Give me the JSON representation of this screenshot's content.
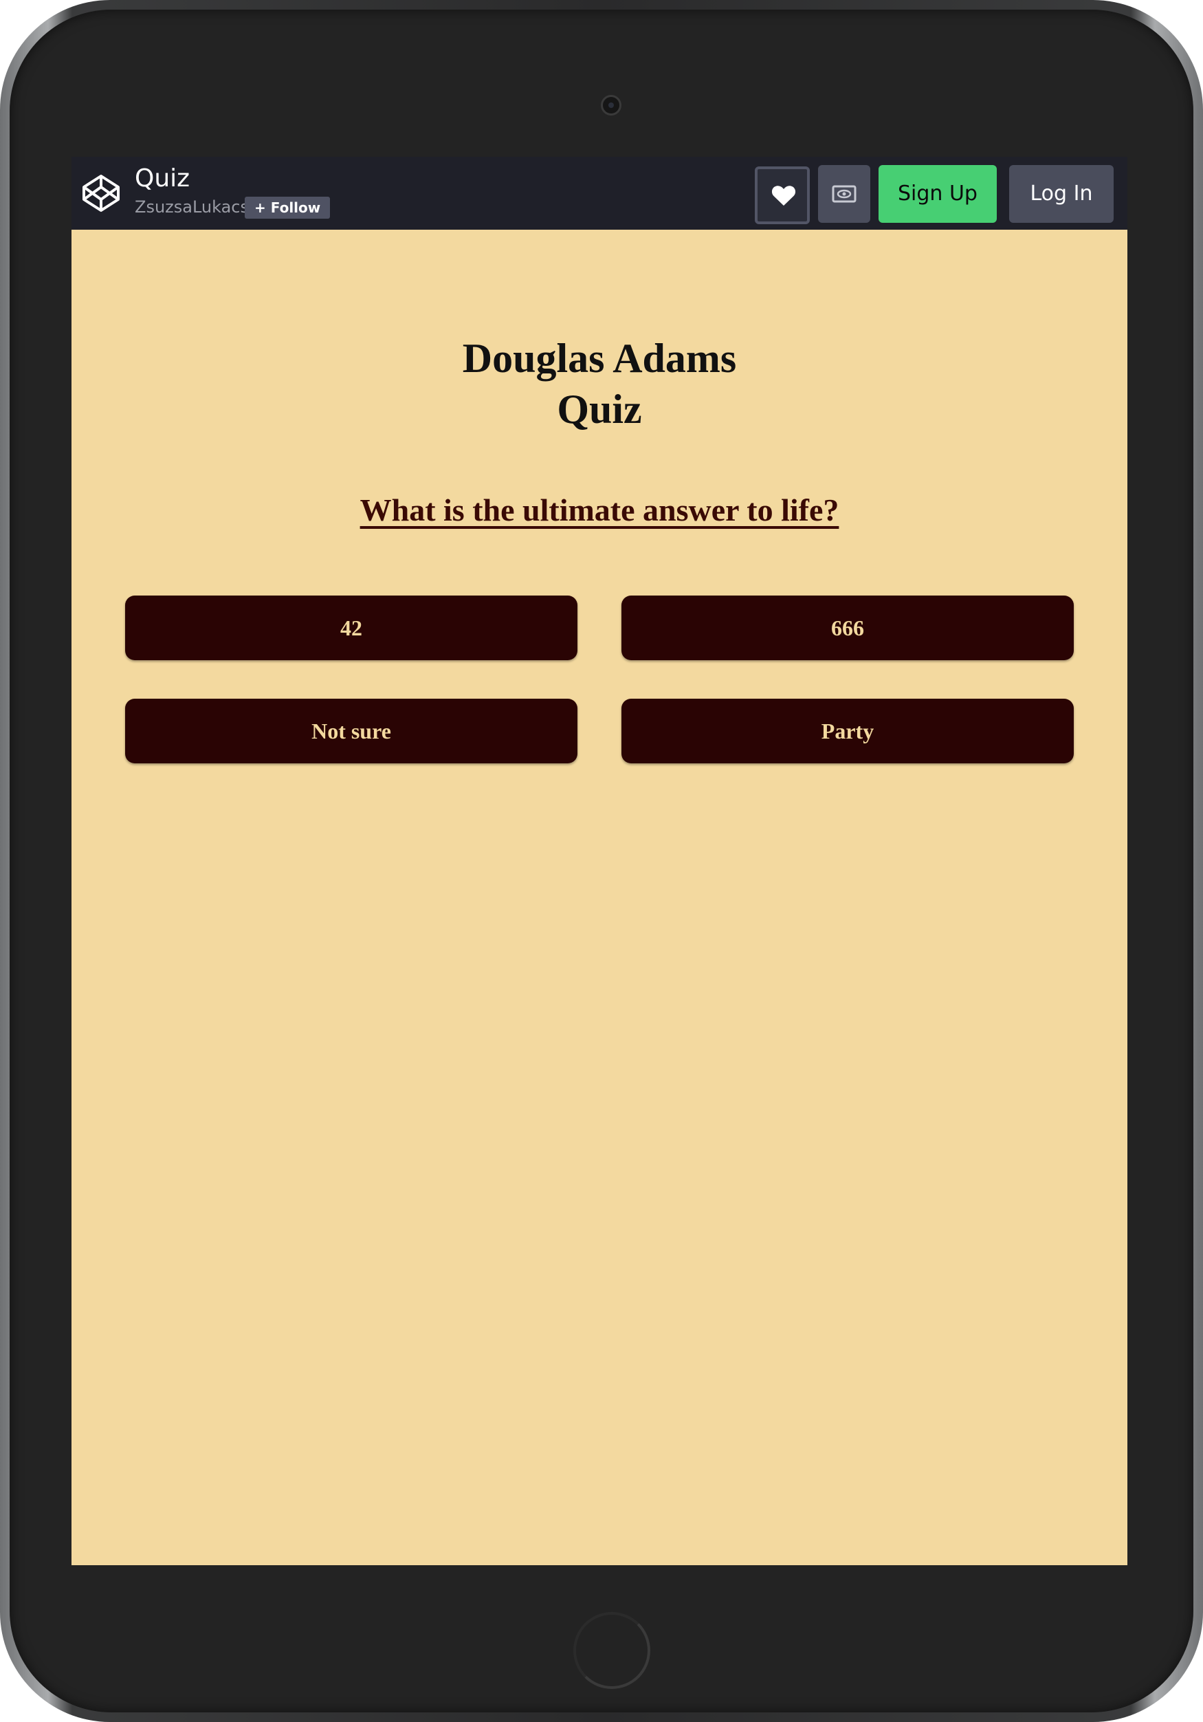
{
  "topbar": {
    "pen_title": "Quiz",
    "author": "ZsuzsaLukacs",
    "follow_label": "+ Follow",
    "signup_label": "Sign Up",
    "login_label": "Log In"
  },
  "quiz": {
    "title_line1": "Douglas Adams",
    "title_line2": "Quiz",
    "question": "What is the ultimate answer to life?",
    "answers": [
      "42",
      "666",
      "Not sure",
      "Party"
    ]
  },
  "colors": {
    "page_background": "#f3d99f",
    "answer_button": "#2a0404",
    "answer_text": "#f3d99f",
    "topbar": "#1f2029",
    "signup_accent": "#47cf73"
  }
}
